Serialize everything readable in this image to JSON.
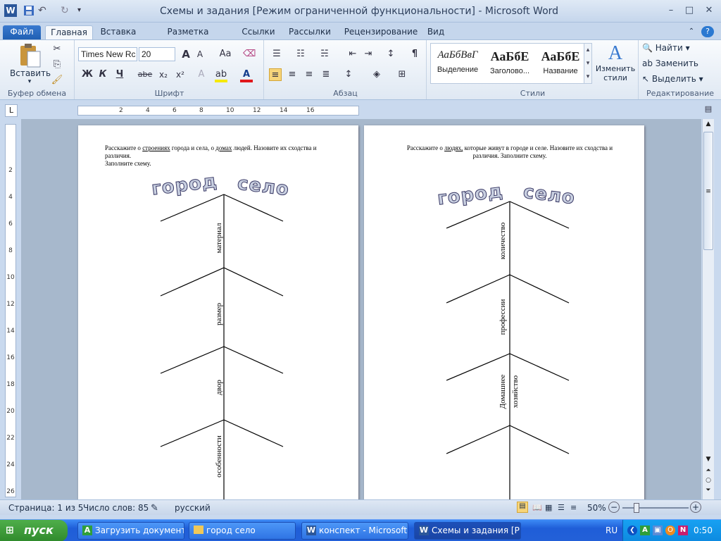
{
  "window": {
    "title": "Схемы и задания [Режим ограниченной функциональности]  -  Microsoft Word",
    "qat_icons": [
      "word-icon",
      "save-icon",
      "undo-icon",
      "redo-icon",
      "customize-icon"
    ],
    "buttons": {
      "minimize": "–",
      "maximize": "□",
      "close": "✕"
    }
  },
  "tabs": [
    "Файл",
    "Главная",
    "Вставка",
    "Разметка страницы",
    "Ссылки",
    "Рассылки",
    "Рецензирование",
    "Вид"
  ],
  "ribbon": {
    "clipboard": {
      "label": "Буфер обмена",
      "paste": "Вставить"
    },
    "font": {
      "label": "Шрифт",
      "font_name": "Times New Rc",
      "font_size": "20",
      "bold": "Ж",
      "italic": "К",
      "underline": "Ч",
      "strike": "abe",
      "sub": "x₂",
      "sup": "x²",
      "grow": "A",
      "shrink": "A",
      "case": "Aa"
    },
    "paragraph": {
      "label": "Абзац",
      "pilcrow": "¶"
    },
    "styles": {
      "label": "Стили",
      "tiles": [
        {
          "sample": "АаБбВвГ",
          "name": "Выделение"
        },
        {
          "sample": "АаБбЕ",
          "name": "Заголово..."
        },
        {
          "sample": "АаБбЕ",
          "name": "Название"
        }
      ],
      "change": "Изменить стили"
    },
    "editing": {
      "label": "Редактирование",
      "find": "Найти",
      "replace": "Заменить",
      "select": "Выделить"
    }
  },
  "ruler": {
    "h_ticks": [
      "2",
      "4",
      "6",
      "8",
      "10",
      "12",
      "14",
      "16"
    ],
    "v_ticks": [
      "2",
      "4",
      "6",
      "8",
      "10",
      "12",
      "14",
      "16",
      "18",
      "20",
      "22",
      "24",
      "26"
    ]
  },
  "page1": {
    "line1_pre": "Расскажите  о ",
    "line1_u1": "строениях",
    "line1_mid": " города и села, о ",
    "line1_u2": "домах",
    "line1_post": " людей. Назовите их сходства и",
    "line2": "различия.",
    "line3": "Заполните схему.",
    "wordart_left": "город",
    "wordart_right": "село",
    "labels": [
      "материал",
      "размер",
      "двор",
      "особенности"
    ]
  },
  "page2": {
    "line1_pre": "Расскажите  о  ",
    "line1_u1": "людях,",
    "line1_post": " которые живут  в  городе и селе. Назовите их сходства и",
    "line2": "различия. Заполните схему.",
    "wordart_left": "город",
    "wordart_right": "село",
    "labels": [
      "количество",
      "профессии",
      "Домашнее",
      "хозяйство"
    ]
  },
  "status": {
    "page": "Страница: 1 из 5",
    "words": "Число слов: 85",
    "lang": "русский",
    "zoom": "50%"
  },
  "taskbar": {
    "start": "пуск",
    "tasks": [
      "Загрузить документ...",
      "город село",
      "конспект - Microsoft ...",
      "Схемы и задания [Р..."
    ],
    "lang": "RU",
    "clock": "0:50"
  },
  "colors": {
    "accent": "#2b579a",
    "taskbar": "#245edb",
    "start": "#3c9a37"
  }
}
